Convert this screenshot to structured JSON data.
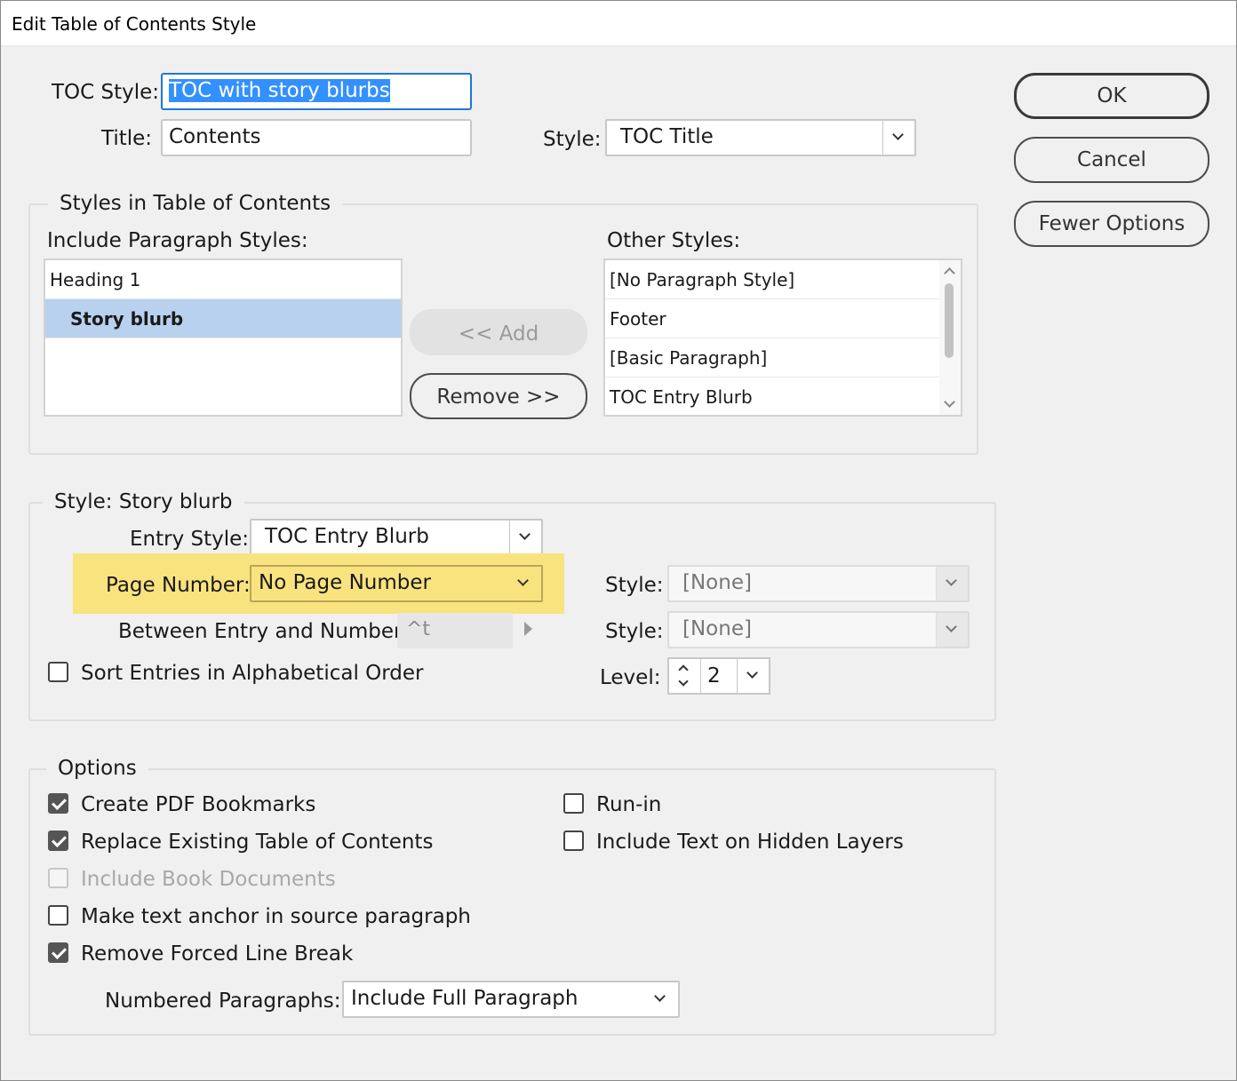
{
  "window": {
    "title": "Edit Table of Contents Style"
  },
  "top": {
    "toc_style_label": "TOC Style:",
    "toc_style_value": "TOC with story blurbs",
    "title_label": "Title:",
    "title_value": "Contents",
    "style_label": "Style:",
    "style_value": "TOC Title"
  },
  "buttons": {
    "ok": "OK",
    "cancel": "Cancel",
    "fewer_options": "Fewer Options"
  },
  "styles_group": {
    "legend": "Styles in Table of Contents",
    "include_label": "Include Paragraph Styles:",
    "include_items": [
      "Heading 1",
      "Story blurb"
    ],
    "selected_index": 1,
    "add_button": "<< Add",
    "remove_button": "Remove >>",
    "other_label": "Other Styles:",
    "other_items": [
      "[No Paragraph Style]",
      "Footer",
      "[Basic Paragraph]",
      "TOC Entry Blurb"
    ]
  },
  "style_group": {
    "legend": "Style: Story blurb",
    "entry_style_label": "Entry Style:",
    "entry_style_value": "TOC Entry Blurb",
    "page_number_label": "Page Number:",
    "page_number_value": "No Page Number",
    "highlight_color": "#f9e37f",
    "between_label": "Between Entry and Number:",
    "between_value": "^t",
    "sort_label": "Sort Entries in Alphabetical Order",
    "sort_checked": false,
    "style1_label": "Style:",
    "style1_value": "[None]",
    "style2_label": "Style:",
    "style2_value": "[None]",
    "level_label": "Level:",
    "level_value": "2"
  },
  "options_group": {
    "legend": "Options",
    "checkboxes": [
      {
        "label": "Create PDF Bookmarks",
        "checked": true,
        "enabled": true
      },
      {
        "label": "Replace Existing Table of Contents",
        "checked": true,
        "enabled": true
      },
      {
        "label": "Include Book Documents",
        "checked": false,
        "enabled": false
      },
      {
        "label": "Make text anchor in source paragraph",
        "checked": false,
        "enabled": true
      },
      {
        "label": "Remove Forced Line Break",
        "checked": true,
        "enabled": true
      },
      {
        "label": "Run-in",
        "checked": false,
        "enabled": true
      },
      {
        "label": "Include Text on Hidden Layers",
        "checked": false,
        "enabled": true
      }
    ],
    "numbered_label": "Numbered Paragraphs:",
    "numbered_value": "Include Full Paragraph"
  }
}
